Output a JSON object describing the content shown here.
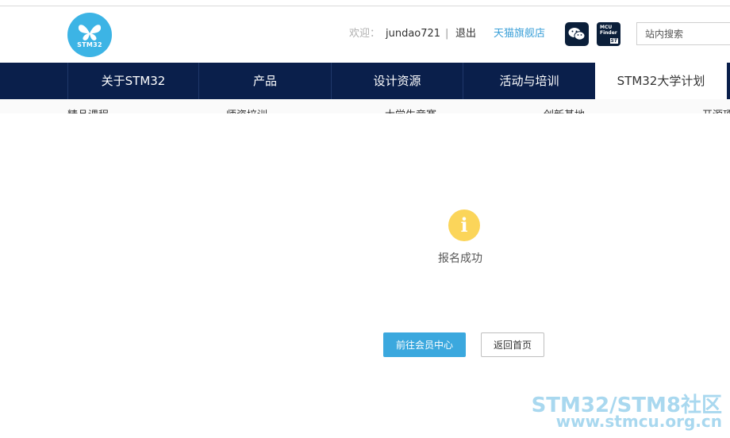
{
  "header": {
    "logo_text": "STM32",
    "welcome_label": "欢迎：",
    "username": "jundao721",
    "separator": "|",
    "logout": "退出",
    "tmall_store": "天猫旗舰店",
    "mcu_finder_line1": "MCU",
    "mcu_finder_line2": "Finder",
    "mcu_finder_brand": "ST",
    "search_placeholder": "站内搜索"
  },
  "nav": {
    "items": [
      {
        "label": "关于STM32"
      },
      {
        "label": "产品"
      },
      {
        "label": "设计资源"
      },
      {
        "label": "活动与培训"
      },
      {
        "label": "STM32大学计划"
      }
    ],
    "active_index": 4
  },
  "subnav": {
    "items": [
      {
        "label": "精品课程"
      },
      {
        "label": "师资培训"
      },
      {
        "label": "大学生竞赛"
      },
      {
        "label": "创新基地"
      },
      {
        "label": "开源项目"
      }
    ]
  },
  "message": {
    "icon": "info-icon",
    "icon_glyph": "i",
    "text": "报名成功"
  },
  "actions": {
    "primary_label": "前往会员中心",
    "secondary_label": "返回首页"
  },
  "watermark": {
    "line1": "STM32/STM8社区",
    "line2": "www.stmcu.org.cn"
  },
  "colors": {
    "nav_background": "#0a1f4b",
    "accent": "#3ba8de",
    "info_icon": "#fbd55a",
    "logo": "#3cb4e5"
  }
}
